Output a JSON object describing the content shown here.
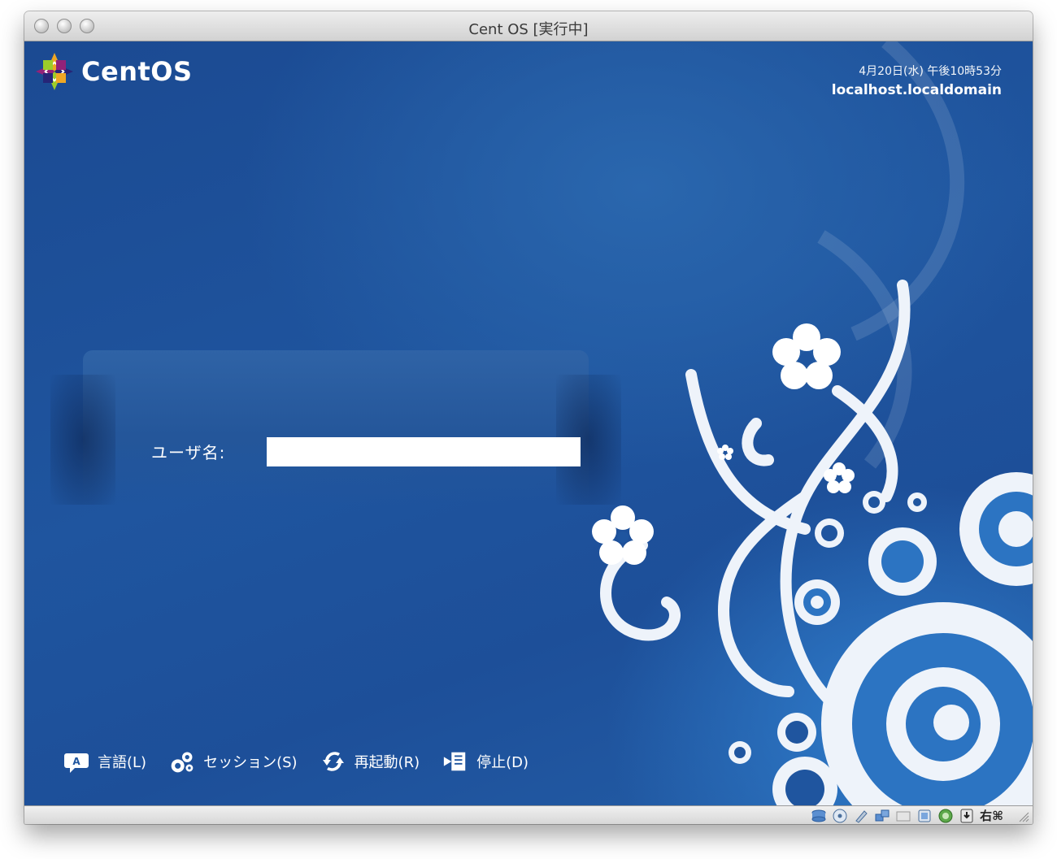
{
  "window": {
    "title": "Cent OS [実行中]"
  },
  "header": {
    "logo_text": "CentOS",
    "date_time": "4月20日(水) 午後10時53分",
    "hostname": "localhost.localdomain"
  },
  "login": {
    "username_label": "ユーザ名:",
    "username_value": "",
    "username_placeholder": ""
  },
  "actions": [
    {
      "label": "言語(L)",
      "icon": "language-icon"
    },
    {
      "label": "セッション(S)",
      "icon": "session-gears-icon"
    },
    {
      "label": "再起動(R)",
      "icon": "restart-icon"
    },
    {
      "label": "停止(D)",
      "icon": "shutdown-icon"
    }
  ],
  "statusbar": {
    "host_key_label": "右⌘",
    "icons": [
      "hard-disk-icon",
      "cd-dvd-icon",
      "usb-icon",
      "network-icon",
      "shared-folders-icon",
      "display-icon",
      "virtualization-icon",
      "mouse-integration-icon"
    ]
  },
  "colors": {
    "background_primary": "#1f559f",
    "background_highlight": "#2f7ccb",
    "panel": "#2f63a6",
    "text": "#ffffff"
  }
}
